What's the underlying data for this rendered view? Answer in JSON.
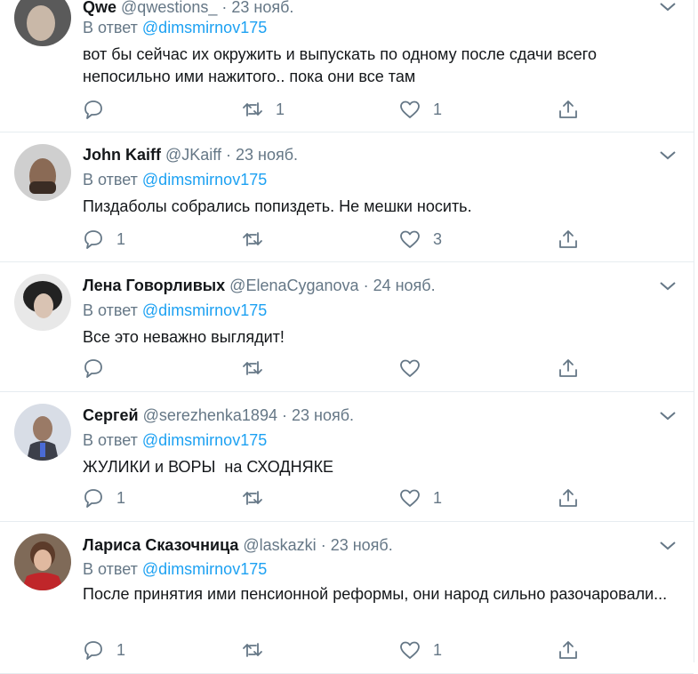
{
  "reply_prefix": "В ответ",
  "tweets": [
    {
      "name": "Qwe",
      "handle": "@qwestions_",
      "separator": "·",
      "date": "23 нояб.",
      "mention": "@dimsmirnov175",
      "text": "вот бы сейчас их окружить и выпускать по одному после сдачи всего непосильно ими нажитого.. пока они все там",
      "replies": "",
      "retweets": "1",
      "likes": "1",
      "avatar_colors": [
        "#5a5a5a",
        "#c9b8a8"
      ]
    },
    {
      "name": "John Kaiff",
      "handle": "@JKaiff",
      "separator": "·",
      "date": "23 нояб.",
      "mention": "@dimsmirnov175",
      "text": "Пиздаболы собрались попиздеть. Не мешки носить.",
      "replies": "1",
      "retweets": "",
      "likes": "3",
      "avatar_colors": [
        "#cfcfcf",
        "#8a6a55"
      ]
    },
    {
      "name": "Лена Говорливых",
      "handle": "@ElenaCyganova",
      "separator": "·",
      "date": "24 нояб.",
      "mention": "@dimsmirnov175",
      "text": "Все это неважно выглядит!",
      "replies": "",
      "retweets": "",
      "likes": "",
      "avatar_colors": [
        "#e8e8e8",
        "#222222"
      ]
    },
    {
      "name": "Сергей",
      "handle": "@serezhenka1894",
      "separator": "·",
      "date": "23 нояб.",
      "mention": "@dimsmirnov175",
      "text": "ЖУЛИКИ и ВОРЫ  на СХОДНЯКЕ",
      "replies": "1",
      "retweets": "",
      "likes": "1",
      "avatar_colors": [
        "#d8dde6",
        "#9a7a66"
      ]
    },
    {
      "name": "Лариса Сказочница",
      "handle": "@laskazki",
      "separator": "·",
      "date": "23 нояб.",
      "mention": "@dimsmirnov175",
      "text": "После принятия ими пенсионной реформы, они народ сильно разочаровали...",
      "replies": "1",
      "retweets": "",
      "likes": "1",
      "avatar_colors": [
        "#7f6a58",
        "#c0262a"
      ]
    }
  ]
}
